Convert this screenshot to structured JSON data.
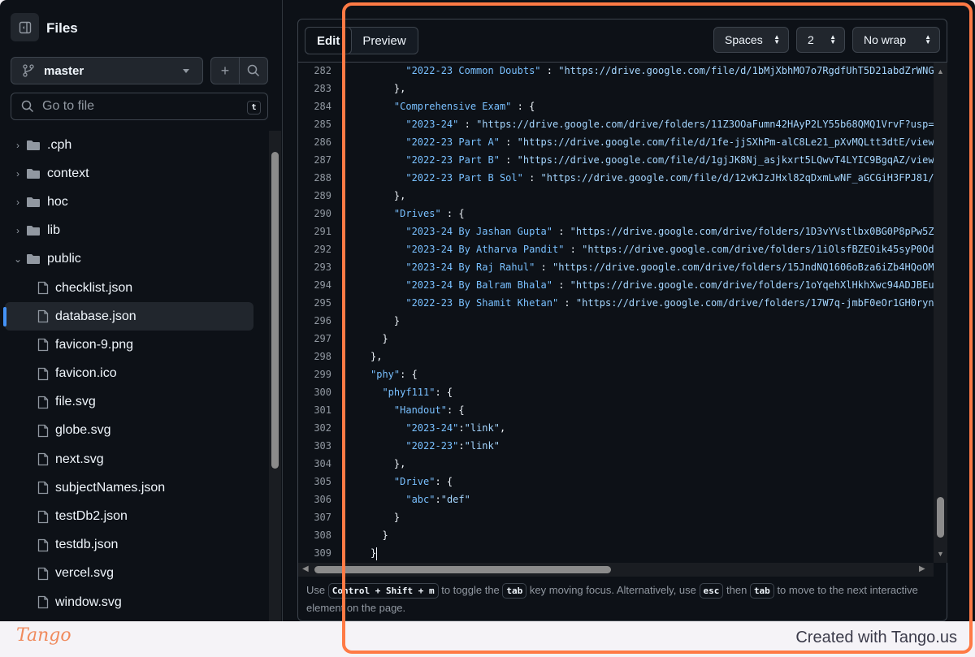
{
  "sidebar": {
    "title": "Files",
    "branch": "master",
    "search_placeholder": "Go to file",
    "search_shortcut": "t",
    "items": [
      {
        "label": ".cph",
        "type": "folder",
        "expanded": false
      },
      {
        "label": "context",
        "type": "folder",
        "expanded": false
      },
      {
        "label": "hoc",
        "type": "folder",
        "expanded": false
      },
      {
        "label": "lib",
        "type": "folder",
        "expanded": false
      },
      {
        "label": "public",
        "type": "folder",
        "expanded": true
      },
      {
        "label": "checklist.json",
        "type": "file"
      },
      {
        "label": "database.json",
        "type": "file",
        "selected": true
      },
      {
        "label": "favicon-9.png",
        "type": "file"
      },
      {
        "label": "favicon.ico",
        "type": "file"
      },
      {
        "label": "file.svg",
        "type": "file"
      },
      {
        "label": "globe.svg",
        "type": "file"
      },
      {
        "label": "next.svg",
        "type": "file"
      },
      {
        "label": "subjectNames.json",
        "type": "file"
      },
      {
        "label": "testDb2.json",
        "type": "file"
      },
      {
        "label": "testdb.json",
        "type": "file"
      },
      {
        "label": "vercel.svg",
        "type": "file"
      },
      {
        "label": "window.svg",
        "type": "file"
      }
    ]
  },
  "editor": {
    "tabs": [
      {
        "label": "Edit",
        "active": true
      },
      {
        "label": "Preview",
        "active": false
      }
    ],
    "indent_mode": "Spaces",
    "indent_size": "2",
    "wrap_mode": "No wrap",
    "lines": [
      {
        "n": "282",
        "text": "      \"2022-23 Common Doubts\" : \"https://drive.google.com/file/d/1bMjXbhMO7o7RgdfUhT5D21abdZrWNG"
      },
      {
        "n": "283",
        "text": "    },"
      },
      {
        "n": "284",
        "text": "    \"Comprehensive Exam\" : {"
      },
      {
        "n": "285",
        "text": "      \"2023-24\" : \"https://drive.google.com/drive/folders/11Z3OOaFumn42HAyP2LY55b68QMQ1VrvF?usp="
      },
      {
        "n": "286",
        "text": "      \"2022-23 Part A\" : \"https://drive.google.com/file/d/1fe-jjSXhPm-alC8Le21_pXvMQLtt3dtE/view"
      },
      {
        "n": "287",
        "text": "      \"2022-23 Part B\" : \"https://drive.google.com/file/d/1gjJK8Nj_asjkxrt5LQwvT4LYIC9BgqAZ/view"
      },
      {
        "n": "288",
        "text": "      \"2022-23 Part B Sol\" : \"https://drive.google.com/file/d/12vKJzJHxl82qDxmLwNF_aGCGiH3FPJ81/"
      },
      {
        "n": "289",
        "text": "    },"
      },
      {
        "n": "290",
        "text": "    \"Drives\" : {"
      },
      {
        "n": "291",
        "text": "      \"2023-24 By Jashan Gupta\" : \"https://drive.google.com/drive/folders/1D3vYVstlbx0BG0P8pPw5Z"
      },
      {
        "n": "292",
        "text": "      \"2023-24 By Atharva Pandit\" : \"https://drive.google.com/drive/folders/1iOlsfBZEOik45syP0Od"
      },
      {
        "n": "293",
        "text": "      \"2023-24 By Raj Rahul\" : \"https://drive.google.com/drive/folders/15JndNQ1606oBza6iZb4HQoOM"
      },
      {
        "n": "294",
        "text": "      \"2023-24 By Balram Bhala\" : \"https://drive.google.com/drive/folders/1oYqehXlHkhXwc94ADJBEu"
      },
      {
        "n": "295",
        "text": "      \"2022-23 By Shamit Khetan\" : \"https://drive.google.com/drive/folders/17W7q-jmbF0eOr1GH0ryn"
      },
      {
        "n": "296",
        "text": "    }"
      },
      {
        "n": "297",
        "text": "  }"
      },
      {
        "n": "298",
        "text": "},"
      },
      {
        "n": "299",
        "text": "\"phy\": {"
      },
      {
        "n": "300",
        "text": "  \"phyf111\": {"
      },
      {
        "n": "301",
        "text": "    \"Handout\": {"
      },
      {
        "n": "302",
        "text": "      \"2023-24\":\"link\","
      },
      {
        "n": "303",
        "text": "      \"2022-23\":\"link\""
      },
      {
        "n": "304",
        "text": "    },"
      },
      {
        "n": "305",
        "text": "    \"Drive\": {"
      },
      {
        "n": "306",
        "text": "      \"abc\":\"def\""
      },
      {
        "n": "307",
        "text": "    }"
      },
      {
        "n": "308",
        "text": "  }"
      },
      {
        "n": "309",
        "text": "}"
      }
    ],
    "hint": {
      "p1": "Use",
      "k1": "Control + Shift + m",
      "p2": "to toggle the",
      "k2": "tab",
      "p3": "key moving focus. Alternatively, use",
      "k3": "esc",
      "p4": "then",
      "k4": "tab",
      "p5": "to move to the next interactive element on the page."
    }
  },
  "footer": {
    "logo": "Tango",
    "credit": "Created with Tango.us"
  },
  "colors": {
    "accent": "#4493f8",
    "highlight": "#ff7a45",
    "json_key": "#79c0ff",
    "json_string": "#a5d6ff"
  }
}
